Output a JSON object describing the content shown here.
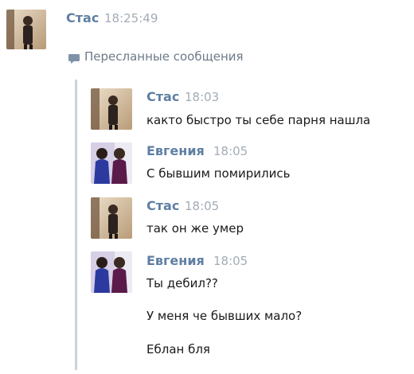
{
  "top_message": {
    "author": "Стас",
    "time": "18:25:49"
  },
  "forwarded": {
    "label": "Пересланные сообщения",
    "messages": [
      {
        "author": "Стас",
        "time": "18:03",
        "lines": [
          "както быстро ты себе парня нашла"
        ]
      },
      {
        "author": "Евгения",
        "time": "18:05",
        "lines": [
          "С бывшим помирились"
        ]
      },
      {
        "author": "Стас",
        "time": "18:05",
        "lines": [
          "так он же умер"
        ]
      },
      {
        "author": "Евгения",
        "time": "18:05",
        "lines": [
          "Ты дебил??",
          "У меня че бывших мало?",
          "Еблан бля"
        ]
      }
    ]
  },
  "colors": {
    "author_name": "#5f7fa3",
    "timestamp": "#a3acb6",
    "quote_bar": "#c8d2dc",
    "message_text": "#1a1a1a"
  }
}
